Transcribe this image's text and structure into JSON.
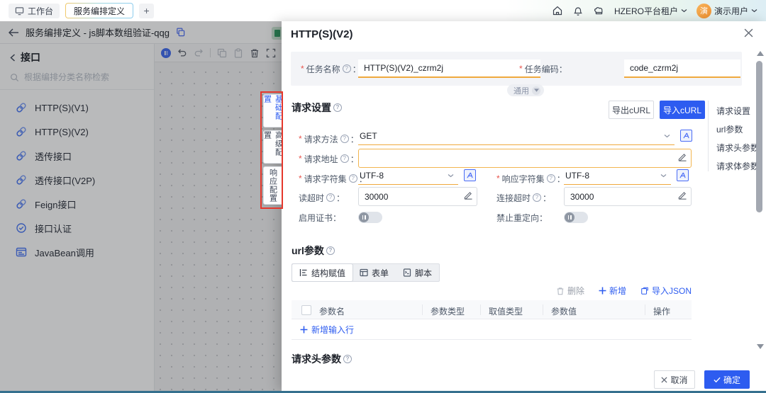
{
  "ui": {
    "colon": "：",
    "required": "*",
    "help": "?"
  },
  "colors": {
    "accent_blue": "#2d5cf0",
    "link_icon_blue": "#4a77f5",
    "warning_underline_orange": "#efa93d",
    "annotation_red": "#e5372c",
    "avatar_orange": "#ef8f2f",
    "bottom_bar_teal": "#35708e"
  },
  "topbar": {
    "workbench_tab": "工作台",
    "active_tab": "服务编排定义",
    "add_tab": "+",
    "tenant": "HZERO平台租户",
    "user": "演示用户",
    "avatar": "演"
  },
  "page_header": {
    "title": "服务编排定义 - js脚本数组验证-qqg"
  },
  "sidebar": {
    "section": "接口",
    "search_placeholder": "根据编排分类名称检索",
    "items": [
      {
        "label": "HTTP(S)(V1)",
        "icon": "link-icon"
      },
      {
        "label": "HTTP(S)(V2)",
        "icon": "link-icon"
      },
      {
        "label": "透传接口",
        "icon": "link-icon"
      },
      {
        "label": "透传接口(V2P)",
        "icon": "link-icon"
      },
      {
        "label": "Feign接口",
        "icon": "link-icon"
      },
      {
        "label": "接口认证",
        "icon": "badge-check-icon"
      },
      {
        "label": "JavaBean调用",
        "icon": "javabean-icon"
      }
    ]
  },
  "config_tabs": [
    {
      "label": "基础配置",
      "active": true
    },
    {
      "label": "高级配置",
      "active": false
    },
    {
      "label": "响应配置",
      "active": false
    }
  ],
  "drawer": {
    "title": "HTTP(S)(V2)",
    "general_toggle": "通用",
    "basic": {
      "task_name": {
        "label": "任务名称",
        "value": "HTTP(S)(V2)_czrm2j"
      },
      "task_code": {
        "label": "任务编码",
        "value": "code_czrm2j"
      }
    },
    "request_settings": {
      "title": "请求设置",
      "export_curl": "导出cURL",
      "import_curl": "导入cURL",
      "method": {
        "label": "请求方法",
        "value": "GET"
      },
      "url": {
        "label": "请求地址",
        "value": ""
      },
      "request_charset": {
        "label": "请求字符集",
        "value": "UTF-8"
      },
      "response_charset": {
        "label": "响应字符集",
        "value": "UTF-8"
      },
      "read_timeout": {
        "label": "读超时",
        "value": "30000"
      },
      "connect_timeout": {
        "label": "连接超时",
        "value": "30000"
      },
      "enable_cert": {
        "label": "启用证书"
      },
      "disable_redirect": {
        "label": "禁止重定向"
      }
    },
    "anchor_nav": [
      "请求设置",
      "url参数",
      "请求头参数",
      "请求体参数"
    ],
    "url_params": {
      "title": "url参数",
      "tabs": [
        "结构赋值",
        "表单",
        "脚本"
      ],
      "actions": {
        "delete": "删除",
        "add": "新增",
        "import_json": "导入JSON"
      },
      "columns": [
        "参数名",
        "参数类型",
        "取值类型",
        "参数值",
        "操作"
      ],
      "add_row": "新增输入行"
    },
    "header_params_title": "请求头参数",
    "footer": {
      "cancel": "取消",
      "ok": "确定"
    }
  }
}
